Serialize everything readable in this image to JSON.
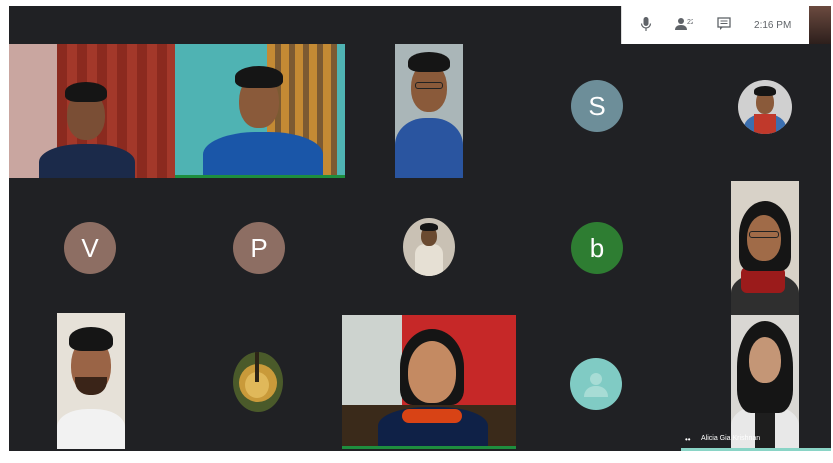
{
  "meeting": {
    "time": "2:16 PM"
  },
  "avatars": {
    "s": {
      "letter": "S",
      "color": "#6d8e99"
    },
    "v": {
      "letter": "V",
      "color": "#8d6e63"
    },
    "p": {
      "letter": "P",
      "color": "#8d6e63"
    },
    "b": {
      "letter": "b",
      "color": "#2e7d32"
    },
    "default": {
      "color": "#80cbc4"
    }
  },
  "participants": {
    "active_speaker_name": "Alicia Gia Krishnan"
  },
  "icons": {
    "mic": "mic-icon",
    "people": "people-icon",
    "chat": "chat-icon"
  }
}
